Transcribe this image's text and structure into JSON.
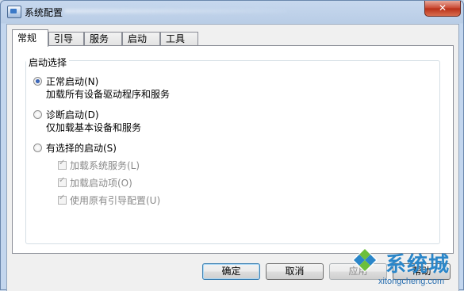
{
  "window": {
    "title": "系统配置",
    "close_label": "✕"
  },
  "tabs": [
    {
      "label": "常规",
      "active": true
    },
    {
      "label": "引导",
      "active": false
    },
    {
      "label": "服务",
      "active": false
    },
    {
      "label": "启动",
      "active": false
    },
    {
      "label": "工具",
      "active": false
    }
  ],
  "startup": {
    "group_label": "启动选择",
    "normal": {
      "label": "正常启动(N)",
      "desc": "加载所有设备驱动程序和服务",
      "selected": true
    },
    "diagnostic": {
      "label": "诊断启动(D)",
      "desc": "仅加载基本设备和服务",
      "selected": false
    },
    "selective": {
      "label": "有选择的启动(S)",
      "selected": false,
      "options": [
        {
          "label": "加载系统服务(L)",
          "checked": true
        },
        {
          "label": "加载启动项(O)",
          "checked": true
        },
        {
          "label": "使用原有引导配置(U)",
          "checked": true
        }
      ]
    }
  },
  "buttons": {
    "ok": "确定",
    "cancel": "取消",
    "apply": "应用",
    "help": "帮助"
  },
  "watermark": {
    "brand": "系统城",
    "url": "xitongcheng.com"
  },
  "colors": {
    "accent": "#3c7fb1",
    "watermark_blue": "#2a86c9",
    "watermark_green": "#6cbf3b"
  }
}
